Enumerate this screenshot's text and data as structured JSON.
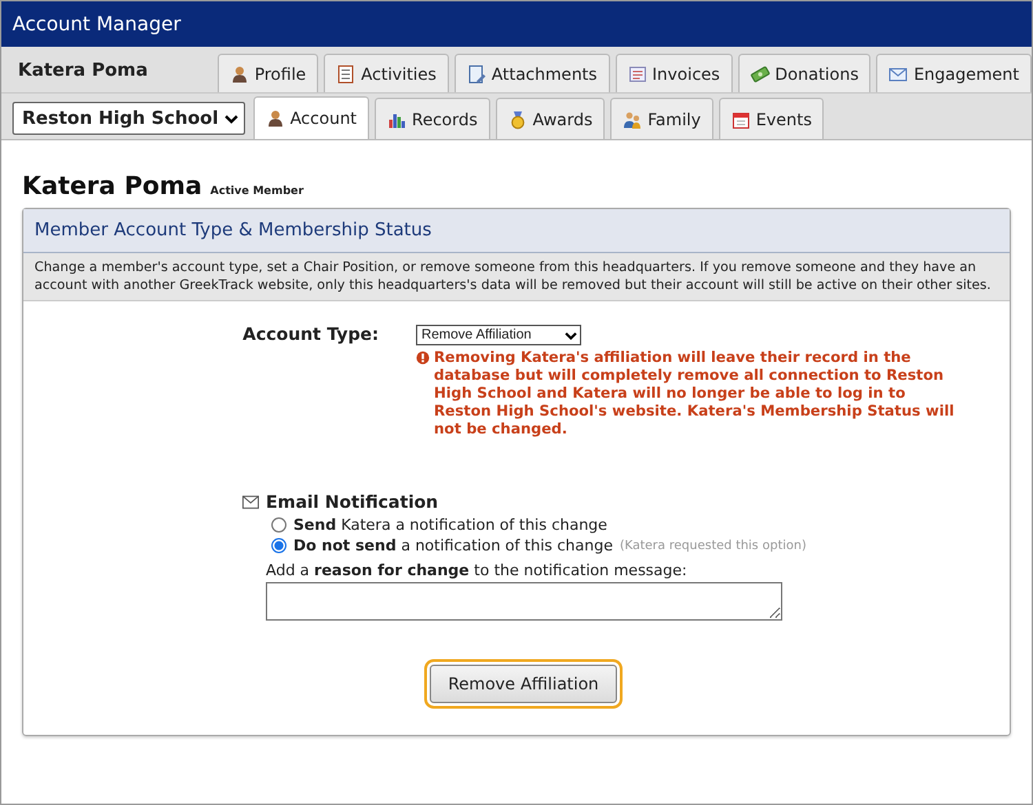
{
  "window": {
    "title": "Account Manager"
  },
  "member_name": "Katera Poma",
  "top_tabs": [
    {
      "label": "Profile",
      "selected": false
    },
    {
      "label": "Activities",
      "selected": false
    },
    {
      "label": "Attachments",
      "selected": false
    },
    {
      "label": "Invoices",
      "selected": false
    },
    {
      "label": "Donations",
      "selected": false
    },
    {
      "label": "Engagement",
      "selected": false
    }
  ],
  "chapter_select": {
    "value": "Reston High School"
  },
  "sub_tabs": [
    {
      "label": "Account",
      "selected": true
    },
    {
      "label": "Records",
      "selected": false
    },
    {
      "label": "Awards",
      "selected": false
    },
    {
      "label": "Family",
      "selected": false
    },
    {
      "label": "Events",
      "selected": false
    }
  ],
  "heading": {
    "name": "Katera Poma",
    "status": "Active Member"
  },
  "panel": {
    "title": "Member Account Type & Membership Status",
    "description": "Change a member's account type, set a Chair Position, or remove someone from this headquarters. If you remove someone and they have an account with another GreekTrack website, only this headquarters's data will be removed but their account will still be active on their other sites.",
    "account_type": {
      "label": "Account Type:",
      "value": "Remove Affiliation",
      "warning": "Removing Katera's affiliation will leave their record in the database but will completely remove all connection to Reston High School and Katera will no longer be able to log in to Reston High School's website. Katera's Membership Status will not be changed."
    },
    "email": {
      "title": "Email Notification",
      "options": [
        {
          "text": "**Send** Katera a notification of this change",
          "selected": false
        },
        {
          "text": "**Do not send** a notification of this change",
          "note": "(Katera requested this option)",
          "selected": true
        }
      ],
      "reason_label": "Add a **reason for change** to the notification message:"
    },
    "submit": "Remove Affiliation"
  }
}
